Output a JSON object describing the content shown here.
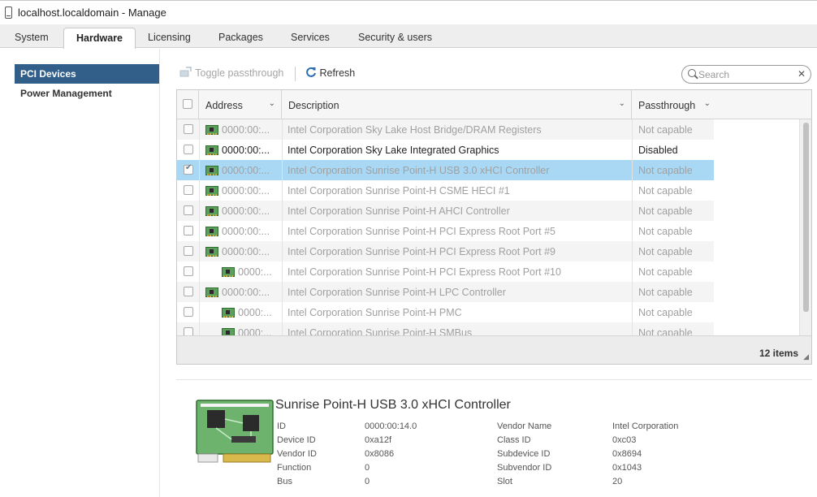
{
  "window": {
    "title": "localhost.localdomain - Manage"
  },
  "tabs": [
    {
      "label": "System"
    },
    {
      "label": "Hardware"
    },
    {
      "label": "Licensing"
    },
    {
      "label": "Packages"
    },
    {
      "label": "Services"
    },
    {
      "label": "Security & users"
    }
  ],
  "active_tab": "Hardware",
  "sidebar": {
    "items": [
      {
        "label": "PCI Devices"
      },
      {
        "label": "Power Management"
      }
    ],
    "active": "PCI Devices"
  },
  "toolbar": {
    "toggle_label": "Toggle passthrough",
    "refresh_label": "Refresh",
    "search_placeholder": "Search",
    "clear_glyph": "✕"
  },
  "table": {
    "columns": [
      {
        "label": "Address"
      },
      {
        "label": "Description"
      },
      {
        "label": "Passthrough"
      }
    ],
    "rows": [
      {
        "address": "0000:00:...",
        "description": "Intel Corporation Sky Lake Host Bridge/DRAM Registers",
        "passthrough": "Not capable",
        "state": "disabled",
        "checked": false,
        "indent": 0
      },
      {
        "address": "0000:00:...",
        "description": "Intel Corporation Sky Lake Integrated Graphics",
        "passthrough": "Disabled",
        "state": "enabled",
        "checked": false,
        "indent": 0
      },
      {
        "address": "0000:00:...",
        "description": "Intel Corporation Sunrise Point-H USB 3.0 xHCI Controller",
        "passthrough": "Not capable",
        "state": "disabled",
        "checked": true,
        "indent": 0
      },
      {
        "address": "0000:00:...",
        "description": "Intel Corporation Sunrise Point-H CSME HECI #1",
        "passthrough": "Not capable",
        "state": "disabled",
        "checked": false,
        "indent": 0
      },
      {
        "address": "0000:00:...",
        "description": "Intel Corporation Sunrise Point-H AHCI Controller",
        "passthrough": "Not capable",
        "state": "disabled",
        "checked": false,
        "indent": 0
      },
      {
        "address": "0000:00:...",
        "description": "Intel Corporation Sunrise Point-H PCI Express Root Port #5",
        "passthrough": "Not capable",
        "state": "disabled",
        "checked": false,
        "indent": 0
      },
      {
        "address": "0000:00:...",
        "description": "Intel Corporation Sunrise Point-H PCI Express Root Port #9",
        "passthrough": "Not capable",
        "state": "disabled",
        "checked": false,
        "indent": 0
      },
      {
        "address": "0000:...",
        "description": "Intel Corporation Sunrise Point-H PCI Express Root Port #10",
        "passthrough": "Not capable",
        "state": "disabled",
        "checked": false,
        "indent": 1
      },
      {
        "address": "0000:00:...",
        "description": "Intel Corporation Sunrise Point-H LPC Controller",
        "passthrough": "Not capable",
        "state": "disabled",
        "checked": false,
        "indent": 0
      },
      {
        "address": "0000:...",
        "description": "Intel Corporation Sunrise Point-H PMC",
        "passthrough": "Not capable",
        "state": "disabled",
        "checked": false,
        "indent": 1
      },
      {
        "address": "0000:...",
        "description": "Intel Corporation Sunrise Point-H SMBus",
        "passthrough": "Not capable",
        "state": "disabled",
        "checked": false,
        "indent": 1
      }
    ],
    "footer": {
      "count": "12 items"
    }
  },
  "details": {
    "title": "Sunrise Point-H USB 3.0 xHCI Controller",
    "left": [
      {
        "label": "ID",
        "value": "0000:00:14.0"
      },
      {
        "label": "Device ID",
        "value": "0xa12f"
      },
      {
        "label": "Vendor ID",
        "value": "0x8086"
      },
      {
        "label": "Function",
        "value": "0"
      },
      {
        "label": "Bus",
        "value": "0"
      }
    ],
    "right": [
      {
        "label": "Vendor Name",
        "value": "Intel Corporation"
      },
      {
        "label": "Class ID",
        "value": "0xc03"
      },
      {
        "label": "Subdevice ID",
        "value": "0x8694"
      },
      {
        "label": "Subvendor ID",
        "value": "0x1043"
      },
      {
        "label": "Slot",
        "value": "20"
      }
    ]
  },
  "colors": {
    "sidebar_active": "#315f89",
    "row_selected": "#a9d8f5",
    "refresh_icon": "#2a6db5",
    "pci_green": "#5aa05a"
  }
}
